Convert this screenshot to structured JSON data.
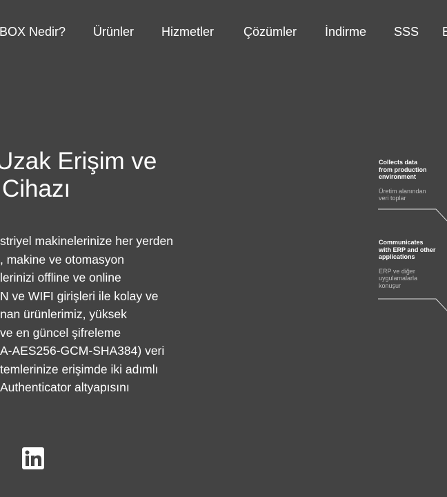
{
  "nav": {
    "items": [
      {
        "label": "BOX Nedir?"
      },
      {
        "label": "Ürünler"
      },
      {
        "label": "Hizmetler"
      },
      {
        "label": "Çözümler"
      },
      {
        "label": "İndirme"
      },
      {
        "label": "SSS"
      },
      {
        "label": "E"
      }
    ]
  },
  "hero": {
    "title_lines": [
      "Uzak Erişim ve",
      "Cihazı"
    ],
    "body_lines": [
      "striyel makinelerinize her yerden",
      ", makine ve otomasyon",
      "lerinizi offline ve online",
      "N ve WIFI girişleri ile kolay ve",
      "nan ürünlerimiz, yüksek",
      "ve en güncel şifreleme",
      "A-AES256-GCM-SHA384) veri",
      "temlerinize erişimde iki adımlı",
      "Authenticator altyapısını"
    ]
  },
  "diagram": {
    "items": [
      {
        "title_lines": [
          "Collects data",
          "from production",
          "environment"
        ],
        "sub_lines": [
          "Üretim alanından",
          "veri toplar"
        ]
      },
      {
        "title_lines": [
          "Communicates",
          "with ERP and other",
          "applications"
        ],
        "sub_lines": [
          "ERP ve diğer",
          "uygulamalarla",
          "konuşur"
        ]
      }
    ]
  },
  "social": {
    "linkedin_icon": "linkedin-icon"
  },
  "colors": {
    "background": "#434343",
    "text": "#ffffff",
    "muted": "#bdbdbd"
  }
}
